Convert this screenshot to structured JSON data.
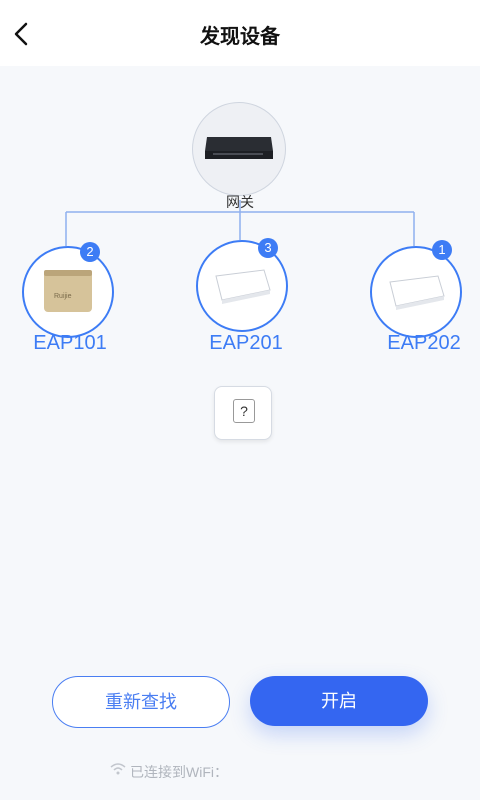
{
  "header": {
    "title": "发现设备",
    "back_icon": "chevron-left-icon"
  },
  "gateway": {
    "label": "网关"
  },
  "nodes": [
    {
      "name": "EAP101",
      "badge": "2"
    },
    {
      "name": "EAP201",
      "badge": "3"
    },
    {
      "name": "EAP202",
      "badge": "1"
    }
  ],
  "unknown": {
    "symbol": "?"
  },
  "actions": {
    "rescan": "重新查找",
    "enable": "开启"
  },
  "wifi_status": {
    "text": "已连接到WiFi："
  },
  "colors": {
    "accent": "#3d7cf5",
    "primary_button": "#3466f1"
  }
}
